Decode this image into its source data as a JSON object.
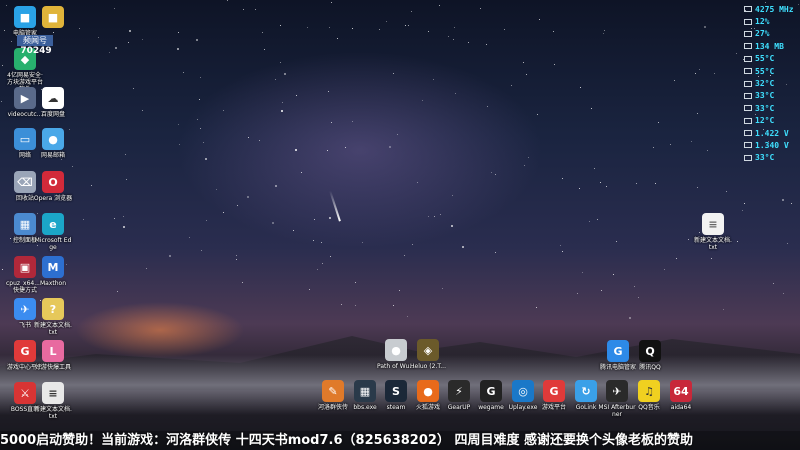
{
  "desktop": {
    "badge_label": "频闻号",
    "badge_count": "70249",
    "icons_left": [
      {
        "id": "security",
        "label": "电脑管家",
        "color": "#2aa2e6",
        "glyph": "■"
      },
      {
        "id": "folder",
        "label": "",
        "color": "#e0b43a",
        "glyph": "■"
      },
      {
        "id": "game-accel",
        "label": "4亿网易安全·方块游戏平台软件",
        "color": "#28b06e",
        "glyph": "◆"
      },
      {
        "id": "video",
        "label": "videocutc...",
        "color": "#5a6a8a",
        "glyph": "▶"
      },
      {
        "id": "baidu-pan",
        "label": "百度网盘",
        "color": "#ffffff",
        "glyph": "☁"
      },
      {
        "id": "network",
        "label": "网络",
        "color": "#3c8fd8",
        "glyph": "▭"
      },
      {
        "id": "browser2",
        "label": "网易邮箱",
        "color": "#4aa8e8",
        "glyph": "●"
      },
      {
        "id": "recycle",
        "label": "回收站",
        "color": "#9aa5b8",
        "glyph": "⌫"
      },
      {
        "id": "opera",
        "label": "Opera 浏览器",
        "color": "#d22a3a",
        "glyph": "O"
      },
      {
        "id": "control",
        "label": "控制面板",
        "color": "#4b8ad0",
        "glyph": "▦"
      },
      {
        "id": "edge",
        "label": "Microsoft Edge",
        "color": "#1ba6c8",
        "glyph": "e"
      },
      {
        "id": "cpuz",
        "label": "cpuz_x64... - 快捷方式",
        "color": "#b0283a",
        "glyph": "▣"
      },
      {
        "id": "maxthon",
        "label": "Maxthon",
        "color": "#2d6fd0",
        "glyph": "M"
      },
      {
        "id": "feishu",
        "label": "飞书",
        "color": "#3b8cf0",
        "glyph": "✈"
      },
      {
        "id": "notes",
        "label": "新建文本文档.txt",
        "color": "#e6c85a",
        "glyph": "?"
      },
      {
        "id": "game-center",
        "label": "游戏中心平台",
        "color": "#e03a3a",
        "glyph": "G"
      },
      {
        "id": "lal4",
        "label": "好游快爆工具",
        "color": "#e86aa0",
        "glyph": "L"
      },
      {
        "id": "boss",
        "label": "BOSS直聘",
        "color": "#d83434",
        "glyph": "⚔"
      },
      {
        "id": "file",
        "label": "新建文本文档.txt",
        "color": "#e8e8e8",
        "glyph": "≡"
      }
    ],
    "icons_mid": [
      {
        "id": "path-of-wuxia",
        "label": "Path of Wu...",
        "color": "#c8ccd0",
        "glyph": "●"
      },
      {
        "id": "heluo",
        "label": "Heluo (2.T...",
        "color": "#6b5a2a",
        "glyph": "◈"
      }
    ],
    "icons_right": [
      {
        "id": "tencent-pc",
        "label": "腾讯电脑管家",
        "color": "#2d8ae8",
        "glyph": "G"
      },
      {
        "id": "qq",
        "label": "腾讯QQ",
        "color": "#111111",
        "glyph": "Q"
      }
    ],
    "desktop_file": {
      "label": "新建文本文档.txt"
    },
    "taskbar_row": [
      {
        "id": "game-a",
        "label": "河洛群侠传",
        "color": "#e07a2a",
        "glyph": "✎"
      },
      {
        "id": "bbs",
        "label": "bbs.exe",
        "color": "#2a3a4a",
        "glyph": "▦"
      },
      {
        "id": "steam",
        "label": "steam",
        "color": "#1b2838",
        "glyph": "S"
      },
      {
        "id": "huohu",
        "label": "火狐游戏",
        "color": "#e86a1a",
        "glyph": "●"
      },
      {
        "id": "gearup",
        "label": "GearUP",
        "color": "#2a2a2a",
        "glyph": "⚡"
      },
      {
        "id": "wegame",
        "label": "wegame",
        "color": "#222222",
        "glyph": "G"
      },
      {
        "id": "uplay",
        "label": "Uplay.exe",
        "color": "#1a78c8",
        "glyph": "◎"
      },
      {
        "id": "tencent-game",
        "label": "游戏平台",
        "color": "#e03a3a",
        "glyph": "G"
      },
      {
        "id": "golink",
        "label": "GoLink",
        "color": "#3aa0e8",
        "glyph": "↻"
      },
      {
        "id": "msi",
        "label": "MSI Afterburner",
        "color": "#2a2a2a",
        "glyph": "✈"
      },
      {
        "id": "qqmusic",
        "label": "QQ音乐",
        "color": "#f0d020",
        "glyph": "♫"
      },
      {
        "id": "aida64",
        "label": "aida64",
        "color": "#c8283a",
        "glyph": "64"
      }
    ]
  },
  "hardware_monitor": [
    {
      "icon": "cpu-clock-icon",
      "value": "4275 MHz"
    },
    {
      "icon": "cpu-load-icon",
      "value": "12%"
    },
    {
      "icon": "gpu-load-icon",
      "value": "27%"
    },
    {
      "icon": "memory-icon",
      "value": "134 MB"
    },
    {
      "icon": "cpu-temp-icon",
      "value": "55°C"
    },
    {
      "icon": "gpu-temp-icon",
      "value": "55°C"
    },
    {
      "icon": "board-temp-icon",
      "value": "32°C"
    },
    {
      "icon": "disk1-temp-icon",
      "value": "33°C"
    },
    {
      "icon": "disk2-temp-icon",
      "value": "33°C"
    },
    {
      "icon": "disk3-temp-icon",
      "value": "12°C"
    },
    {
      "icon": "core-voltage-icon",
      "value": "1.422 V"
    },
    {
      "icon": "gpu-voltage-icon",
      "value": "1.340 V"
    },
    {
      "icon": "vrm-temp-icon",
      "value": "33°C"
    }
  ],
  "ticker": {
    "text": "5000启动赞助！当前游戏：河洛群侠传 十四天书mod7.6（825638202）  四周目难度  感谢还要换个头像老板的赞助"
  }
}
